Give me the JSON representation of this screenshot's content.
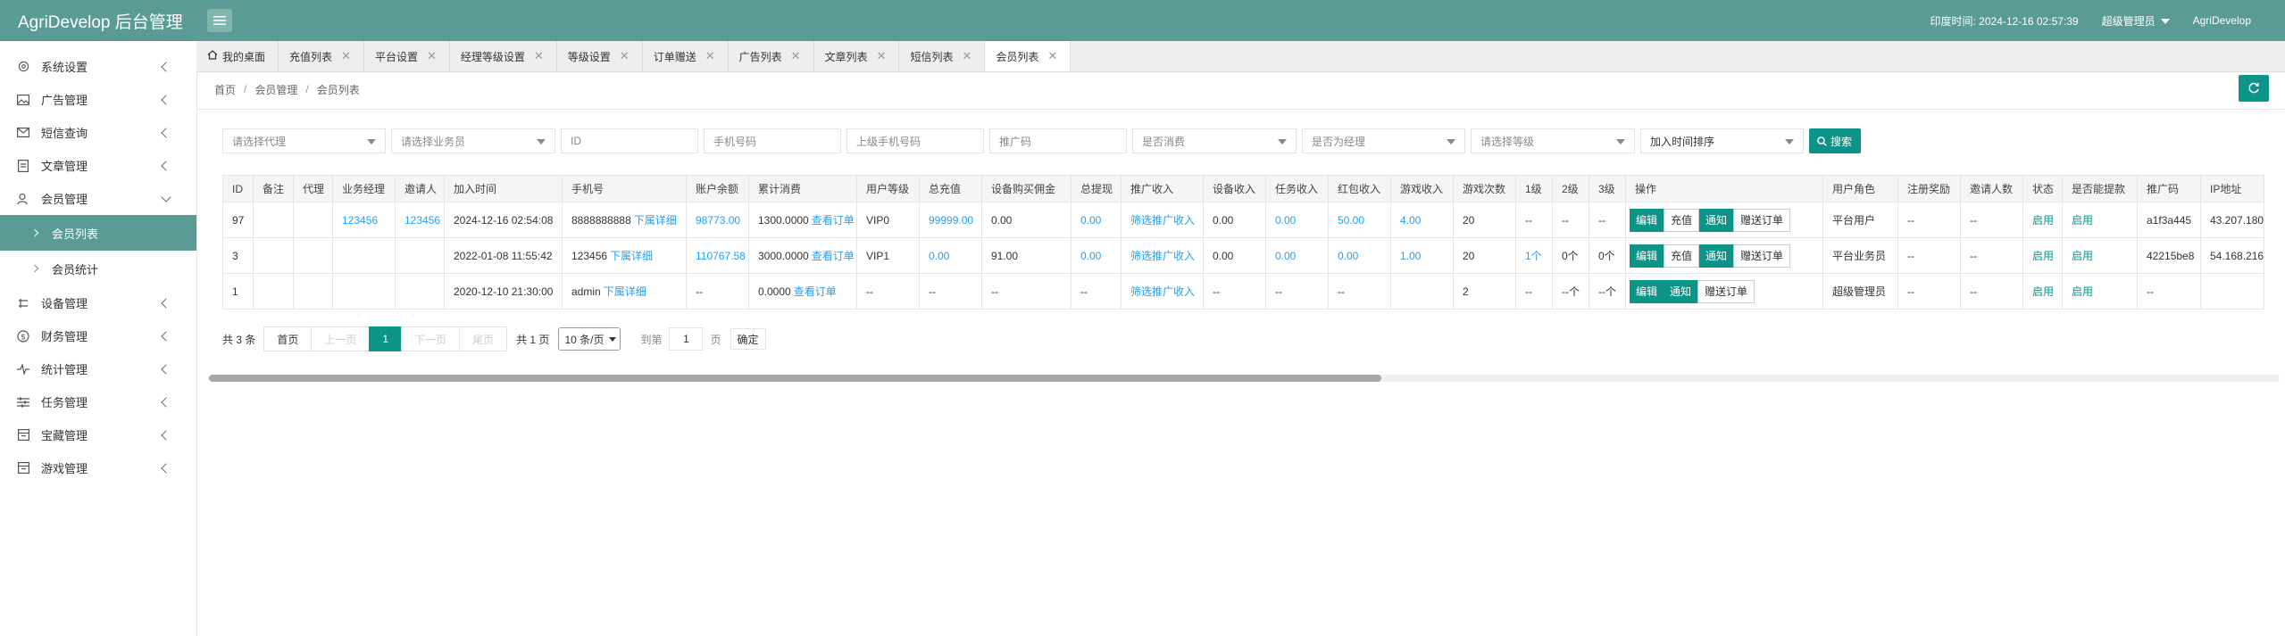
{
  "app": {
    "title": "AgriDevelop 后台管理"
  },
  "header": {
    "login_time": "印度时间: 2024-12-16 02:57:39",
    "role": "超级管理员",
    "user": "AgriDevelop"
  },
  "sidebar": {
    "items": [
      {
        "label": "系统设置",
        "icon": "gear-icon"
      },
      {
        "label": "广告管理",
        "icon": "image-icon"
      },
      {
        "label": "短信查询",
        "icon": "envelope-icon"
      },
      {
        "label": "文章管理",
        "icon": "document-icon"
      },
      {
        "label": "会员管理",
        "icon": "user-icon"
      }
    ],
    "sub_items": [
      {
        "label": "会员列表",
        "active": true
      },
      {
        "label": "会员统计",
        "active": false
      }
    ],
    "items2": [
      {
        "label": "设备管理",
        "icon": "device-icon"
      },
      {
        "label": "财务管理",
        "icon": "dollar-icon"
      },
      {
        "label": "统计管理",
        "icon": "pulse-icon"
      },
      {
        "label": "任务管理",
        "icon": "sliders-icon"
      },
      {
        "label": "宝藏管理",
        "icon": "box-icon"
      },
      {
        "label": "游戏管理",
        "icon": "game-icon"
      }
    ]
  },
  "tabs": [
    {
      "label": "我的桌面"
    },
    {
      "label": "充值列表"
    },
    {
      "label": "平台设置"
    },
    {
      "label": "经理等级设置"
    },
    {
      "label": "等级设置"
    },
    {
      "label": "订单赠送"
    },
    {
      "label": "广告列表"
    },
    {
      "label": "文章列表"
    },
    {
      "label": "短信列表"
    },
    {
      "label": "会员列表"
    }
  ],
  "breadcrumb": [
    "首页",
    "会员管理",
    "会员列表"
  ],
  "filters": {
    "agent": "请选择代理",
    "salesman": "请选择业务员",
    "id": "ID",
    "phone": "手机号码",
    "parent_phone": "上级手机号码",
    "promo_code": "推广码",
    "consumed": "是否消费",
    "is_manager": "是否为经理",
    "level": "请选择等级",
    "sort": "加入时间排序",
    "search_label": "搜索"
  },
  "table": {
    "columns": [
      "ID",
      "备注",
      "代理",
      "业务经理",
      "邀请人",
      "加入时间",
      "手机号",
      "账户余额",
      "累计消费",
      "用户等级",
      "总充值",
      "设备购买佣金",
      "总提现",
      "推广收入",
      "设备收入",
      "任务收入",
      "红包收入",
      "游戏收入",
      "游戏次数",
      "1级",
      "2级",
      "3级",
      "操作",
      "用户角色",
      "注册奖励",
      "邀请人数",
      "状态",
      "是否能提款",
      "推广码",
      "IP地址"
    ],
    "rows": [
      {
        "id": "97",
        "remark": "",
        "agent": "",
        "manager": "123456",
        "inviter": "123456",
        "join_time": "2024-12-16 02:54:08",
        "phone": "8888888888",
        "phone_link": "下属详细",
        "balance": "98773.00",
        "consume": "1300.0000",
        "consume_link": "查看订单",
        "level": "VIP0",
        "recharge": "99999.00",
        "device_commission": "0.00",
        "withdraw": "0.00",
        "promo_income": "筛选推广收入",
        "device_income": "0.00",
        "task_income": "0.00",
        "redpacket_income": "50.00",
        "game_income": "4.00",
        "game_count": "20",
        "l1": "--",
        "l2": "--",
        "l3": "--",
        "ops": [
          "编辑",
          "充值",
          "通知",
          "赠送订单"
        ],
        "role": "平台用户",
        "reg_bonus": "--",
        "invite_count": "--",
        "status": "启用",
        "can_withdraw": "启用",
        "promo_code": "a1f3a445",
        "ip": "43.207.180"
      },
      {
        "id": "3",
        "remark": "",
        "agent": "",
        "manager": "",
        "inviter": "",
        "join_time": "2022-01-08 11:55:42",
        "phone": "123456",
        "phone_link": "下属详细",
        "balance": "110767.58",
        "consume": "3000.0000",
        "consume_link": "查看订单",
        "level": "VIP1",
        "recharge": "0.00",
        "device_commission": "91.00",
        "withdraw": "0.00",
        "promo_income": "筛选推广收入",
        "device_income": "0.00",
        "task_income": "0.00",
        "redpacket_income": "0.00",
        "game_income": "1.00",
        "game_count": "20",
        "l1": "1个",
        "l2": "0个",
        "l3": "0个",
        "ops": [
          "编辑",
          "充值",
          "通知",
          "赠送订单"
        ],
        "role": "平台业务员",
        "reg_bonus": "--",
        "invite_count": "--",
        "status": "启用",
        "can_withdraw": "启用",
        "promo_code": "42215be8",
        "ip": "54.168.216"
      },
      {
        "id": "1",
        "remark": "",
        "agent": "",
        "manager": "",
        "inviter": "",
        "join_time": "2020-12-10 21:30:00",
        "phone": "admin",
        "phone_link": "下属详细",
        "balance": "--",
        "consume": "0.0000",
        "consume_link": "查看订单",
        "level": "--",
        "recharge": "--",
        "device_commission": "--",
        "withdraw": "--",
        "promo_income": "筛选推广收入",
        "device_income": "--",
        "task_income": "--",
        "redpacket_income": "--",
        "game_income": "",
        "game_count": "2",
        "l1": "--",
        "l2": "--个",
        "l3": "--个",
        "ops": [
          "编辑",
          "通知",
          "赠送订单"
        ],
        "role": "超级管理员",
        "reg_bonus": "--",
        "invite_count": "--",
        "status": "启用",
        "can_withdraw": "启用",
        "promo_code": "--",
        "ip": ""
      }
    ]
  },
  "pagination": {
    "total": "共 3 条",
    "first": "首页",
    "prev": "上一页",
    "current": "1",
    "next": "下一页",
    "last": "尾页",
    "pages": "共 1 页",
    "page_size": "10 条/页",
    "goto_prefix": "到第",
    "goto_value": "1",
    "goto_suffix": "页",
    "confirm": "确定"
  },
  "scrollbar": {
    "thumb_fraction": 0.566
  },
  "colors": {
    "header": "#5a9c95",
    "accent": "#0d9488",
    "link": "#1e9fff",
    "enabled": "#009688"
  }
}
